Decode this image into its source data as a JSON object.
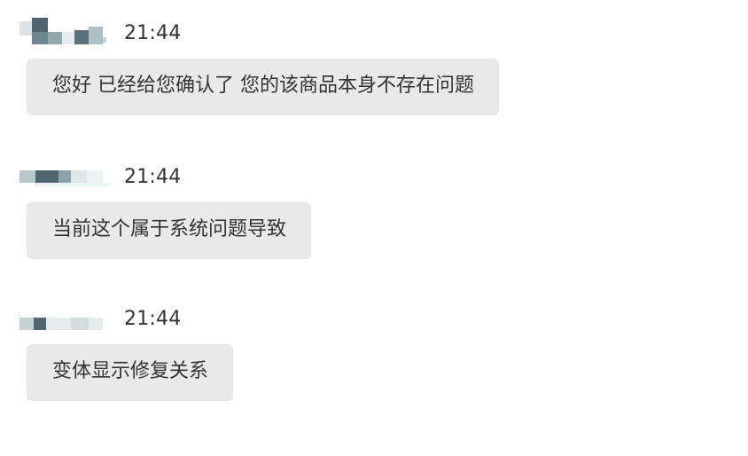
{
  "messages": [
    {
      "time": "21:44",
      "text": "您好 已经给您确认了 您的该商品本身不存在问题"
    },
    {
      "time": "21:44",
      "text": "当前这个属于系统问题导致"
    },
    {
      "time": "21:44",
      "text": "变体显示修复关系"
    }
  ],
  "colors": {
    "bubble": "#e9e9e9",
    "text": "#333333",
    "blur_dark": "#4f6670",
    "blur_mid": "#93a7ae",
    "blur_light": "#dbe3e6"
  }
}
